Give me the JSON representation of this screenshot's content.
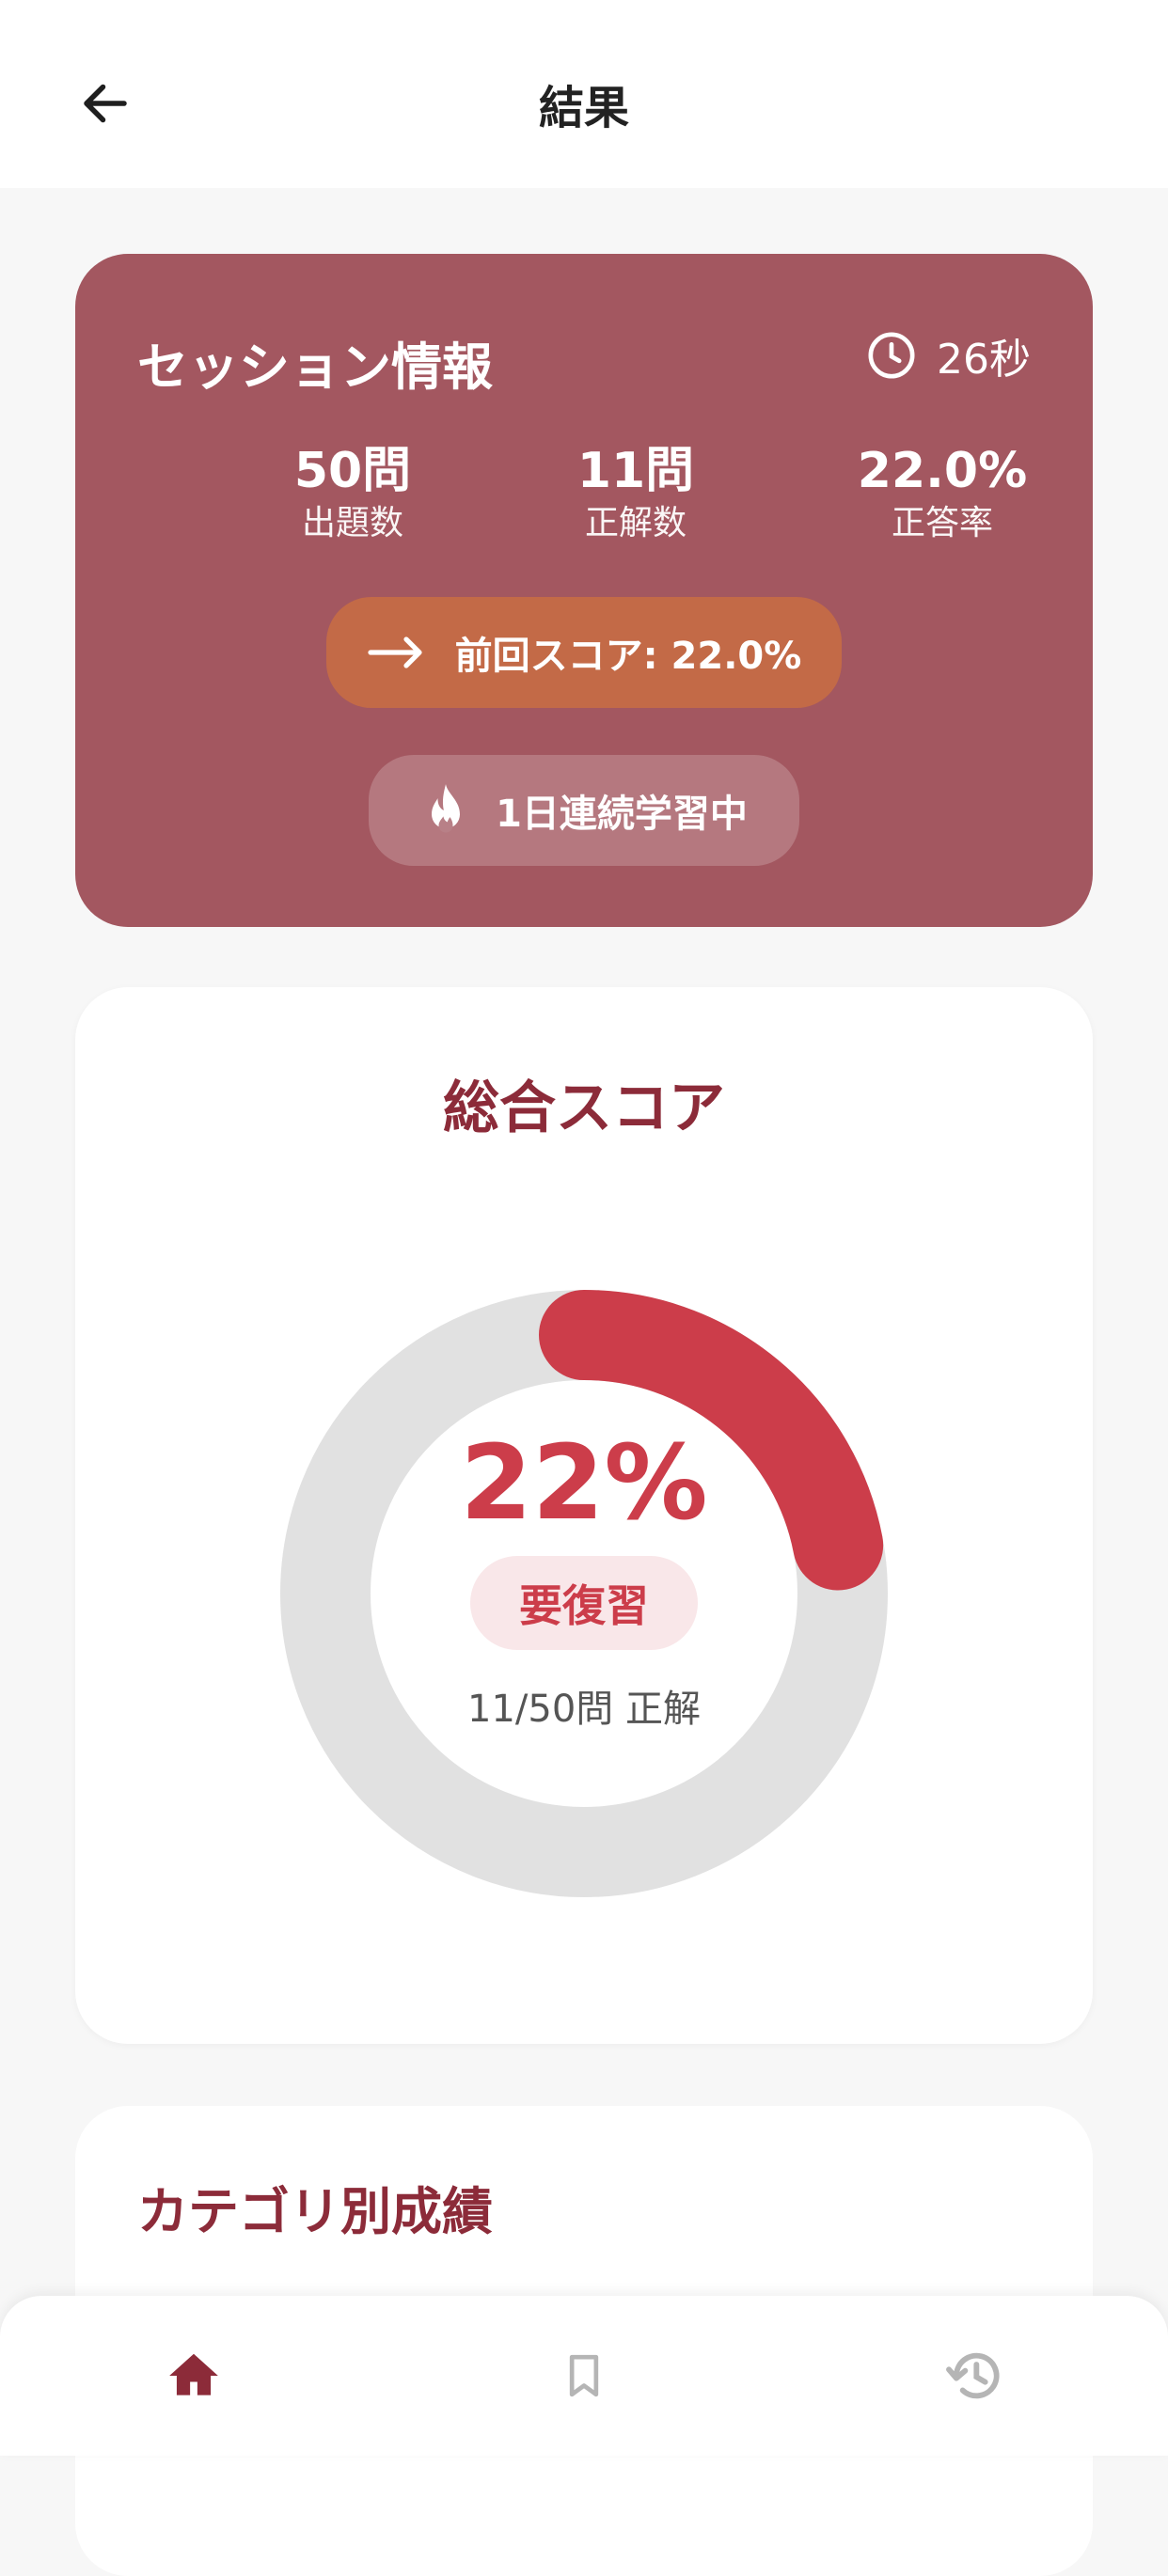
{
  "header": {
    "title": "結果",
    "back_icon": "arrow-left-icon"
  },
  "session": {
    "title": "セッション情報",
    "time": "26秒",
    "time_icon": "clock-icon",
    "stats": [
      {
        "value": "50問",
        "label": "出題数"
      },
      {
        "value": "11問",
        "label": "正解数"
      },
      {
        "value": "22.0%",
        "label": "正答率"
      }
    ],
    "prev_score": "前回スコア: 22.0%",
    "prev_icon": "arrow-right-icon",
    "streak": "1日連続学習中",
    "streak_icon": "flame-icon"
  },
  "score": {
    "title": "総合スコア",
    "percent_text": "22%",
    "percent": 22,
    "status": "要復習",
    "correct_text": "11/50問 正解"
  },
  "category": {
    "title": "カテゴリ別成績"
  },
  "nav": {
    "items": [
      {
        "icon": "home-icon",
        "active": true
      },
      {
        "icon": "bookmark-icon",
        "active": false
      },
      {
        "icon": "history-icon",
        "active": false
      }
    ]
  },
  "colors": {
    "session_card": "#a35760",
    "prev_pill": "#c36a47",
    "accent": "#cc3d4a",
    "title_red": "#8c2b39",
    "track": "#e1e1e1",
    "nav_active": "#8c2b39",
    "nav_inactive": "#b5b5b5"
  }
}
